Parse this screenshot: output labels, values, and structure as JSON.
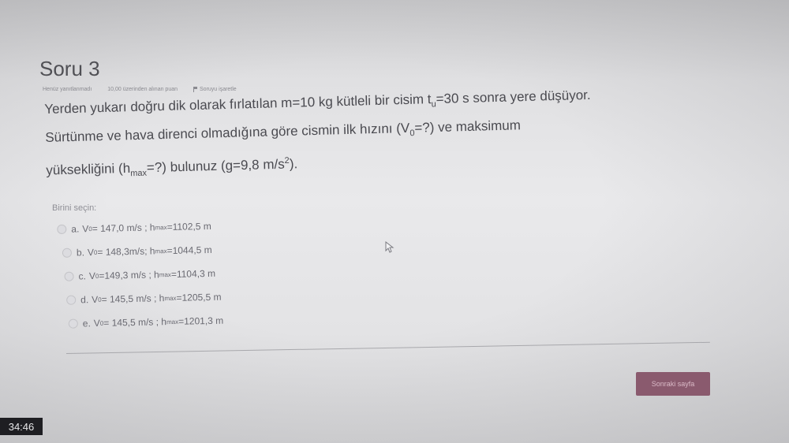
{
  "question": {
    "title": "Soru 3",
    "status": "Henüz yanıtlanmadı",
    "points": "10,00 üzerinden alınan puan",
    "flag_label": "Soruyu işaretle",
    "text": {
      "part1": "Yerden yukarı doğru dik olarak fırlatılan m=10 kg kütleli bir cisim t",
      "sub1": "u",
      "part2": "=30 s sonra yere düşüyor.",
      "part3": "Sürtünme ve hava direnci olmadığına göre cismin ilk hızını (V",
      "sub2": "0",
      "part4": "=?) ve maksimum",
      "part5": "yüksekliğini (h",
      "sub3": "max",
      "part6": "=?) bulunuz (g=9,8 m/s",
      "sup1": "2",
      "part7": ")."
    },
    "prompt": "Birini seçin:"
  },
  "answers": [
    {
      "letter": "a.",
      "v_pre": "V",
      "v_sub": "0",
      "v_val": "= 147,0 m/s ;",
      "h_pre": "h",
      "h_sub": "max",
      "h_val": "=1102,5 m"
    },
    {
      "letter": "b.",
      "v_pre": "V",
      "v_sub": "0",
      "v_val": "= 148,3m/s;",
      "h_pre": "h",
      "h_sub": "max",
      "h_val": "=1044,5 m"
    },
    {
      "letter": "c.",
      "v_pre": "V",
      "v_sub": "0",
      "v_val": "=149,3 m/s ;",
      "h_pre": "h",
      "h_sub": "max",
      "h_val": "=1104,3 m"
    },
    {
      "letter": "d.",
      "v_pre": "V",
      "v_sub": "0",
      "v_val": "= 145,5 m/s ;",
      "h_pre": "h",
      "h_sub": "max",
      "h_val": "=1205,5 m"
    },
    {
      "letter": "e.",
      "v_pre": "V",
      "v_sub": "0",
      "v_val": "= 145,5 m/s ;",
      "h_pre": "h",
      "h_sub": "max",
      "h_val": "=1201,3 m"
    }
  ],
  "navigation": {
    "next_label": "Sonraki sayfa"
  },
  "timer": {
    "value": "34:46"
  },
  "icons": {
    "flag": "flag-icon",
    "cursor": "mouse-cursor-icon"
  },
  "colors": {
    "button_bg": "#8a5a6e",
    "timer_bg": "#1e1e22"
  }
}
